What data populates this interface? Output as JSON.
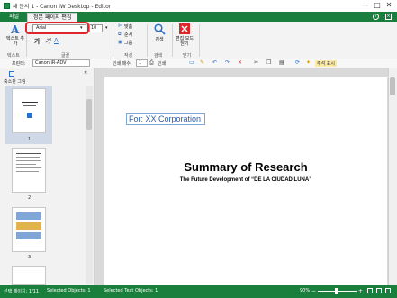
{
  "window": {
    "title": "새 문서 1 - Canon iW Desktop - Editor",
    "controls": [
      "—",
      "□",
      "✕"
    ]
  },
  "menubar": {
    "tabs": [
      "파일",
      "정본 페이지 편집"
    ],
    "icons": [
      "help-icon",
      "close-icon"
    ]
  },
  "ribbon": {
    "text_group": {
      "add_text_label": "텍스트 추가",
      "label": "텍스트"
    },
    "font_group": {
      "font_name": "Arial",
      "font_size": "10",
      "bold": "가",
      "italic": "가",
      "underline": "A",
      "label": "글꼴"
    },
    "arrange_group": {
      "items": [
        "맞춤",
        "순서",
        "그룹"
      ],
      "label": "작성"
    },
    "search_group": {
      "search_label": "검색",
      "label": "검색"
    },
    "close_group": {
      "close_label": "편집 모드 닫기",
      "label": "닫기"
    }
  },
  "toolbar2": {
    "printer_label": "프린터:",
    "printer_value": "Canon iR-ADV",
    "copies_label": "인쇄 매수",
    "copies_value": "1",
    "print_label": "인쇄",
    "annotation_label": "주석 표시"
  },
  "left_pane": {
    "title": "축소판 그림",
    "pages": [
      "1",
      "2",
      "3"
    ]
  },
  "document": {
    "annotation_text": "For: XX Corporation",
    "heading": "Summary of Research",
    "subtitle": "The Future Development of “DE LA CIUDAD LUNA”"
  },
  "statusbar": {
    "page_info": "선택 페이지: 1/11",
    "selected_objects": "Selected Objects: 1",
    "selected_text_objects": "Selected Text Objects: 1",
    "zoom": "90%"
  },
  "colors": {
    "brand_green": "#1a7f3c",
    "highlight_red": "#e0262b",
    "icon_blue": "#2a6fc9"
  }
}
